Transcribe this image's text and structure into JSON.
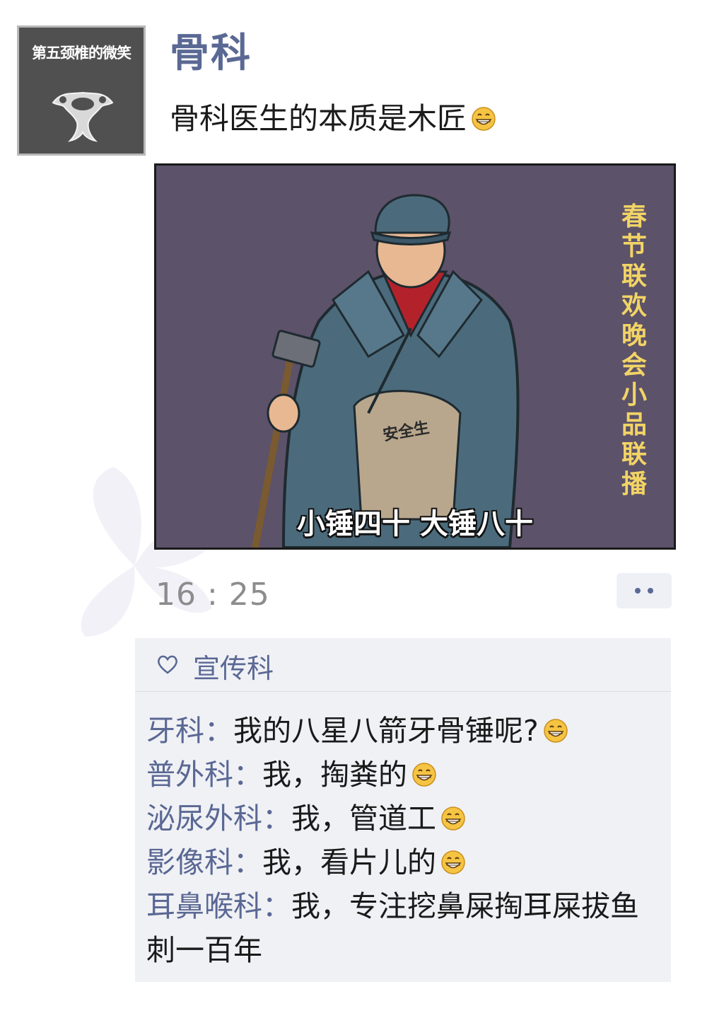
{
  "avatar": {
    "caption": "第五颈椎的微笑",
    "icon": "vertebra-icon"
  },
  "post": {
    "author": "骨科",
    "text": "骨科医生的本质是木匠",
    "emoji": "grin-emoji",
    "image": {
      "vertical_caption": "春节联欢晚会小品联播",
      "bottom_caption": "小锤四十 大锤八十",
      "bag_label": "安全生"
    },
    "time": "16 : 25"
  },
  "likes": {
    "icon": "heart-icon",
    "names": "宣传科"
  },
  "comments": [
    {
      "author": "牙科",
      "separator": "：",
      "text": "我的八星八箭牙骨锤呢?",
      "emoji": true
    },
    {
      "author": "普外科",
      "separator": "：",
      "text": "我，掏粪的",
      "emoji": true
    },
    {
      "author": "泌尿外科",
      "separator": "：",
      "text": "我，管道工",
      "emoji": true
    },
    {
      "author": "影像科",
      "separator": "：",
      "text": "我，看片儿的",
      "emoji": true
    },
    {
      "author": "耳鼻喉科",
      "separator": "：",
      "text": "我，专注挖鼻屎掏耳屎拔鱼刺一百年",
      "emoji": false
    }
  ],
  "colors": {
    "name_blue": "#5a6894",
    "poster_bg": "#5c5269",
    "caption_yellow": "#f2d466",
    "comment_bg": "#f0f1f5"
  }
}
